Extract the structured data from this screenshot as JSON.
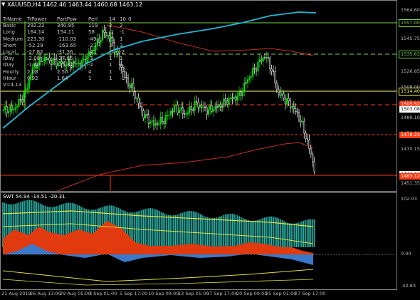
{
  "header": {
    "symbol_icon": "triangle-down-icon",
    "title": "XAUUSD,H4  1462.46 1463.44 1460.68 1463.12"
  },
  "info_table": {
    "columns": [
      "TrName",
      "TrPower",
      "PartPow",
      "Perl",
      "14",
      "10",
      "0"
    ],
    "rows": [
      [
        "Basic",
        "292.22",
        "340.95",
        "119",
        "2",
        "2"
      ],
      [
        "Long",
        "164.14",
        "154.11",
        "58",
        "-1",
        "-1"
      ],
      [
        "Medium",
        "223.30",
        "-110.03",
        "-49",
        "-1",
        "1"
      ],
      [
        "Short",
        "-52.29",
        "-163.65",
        "-21",
        "3",
        "3"
      ],
      [
        "Local",
        "-27.82",
        "-31.36",
        "-21",
        "-1",
        "-2"
      ],
      [
        "IDay",
        "-2.08",
        "-27.85",
        "-1",
        "1",
        "1"
      ],
      [
        "IDay",
        "-1.40",
        "-25.32",
        "-2",
        "1",
        "1"
      ],
      [
        "Hourly",
        "2.08",
        "2.50",
        "4",
        "1",
        "1"
      ],
      [
        "IHour",
        "0.92",
        "1.64",
        "1",
        "1",
        "-1"
      ]
    ],
    "footer": "V=4.13"
  },
  "price_axis": {
    "ticks": [
      "1564.60",
      "1545.75",
      "1526.85",
      "1508.00",
      "1498.60",
      "1489.10",
      "1479.60",
      "1470.15",
      "1451.35"
    ],
    "tags": [
      {
        "text": "1557.00",
        "color": "#7bd44a",
        "bg": "#000"
      },
      {
        "text": "1535.63",
        "color": "#7bd44a",
        "bg": "#000"
      },
      {
        "text": "1514.40",
        "color": "#ffff66",
        "bg": "#000"
      },
      {
        "text": "1505.52",
        "color": "#ffffff",
        "bg": "#ff3b14"
      },
      {
        "text": "1503.08",
        "color": "#000000",
        "bg": "#ffffff"
      },
      {
        "text": "1478.23",
        "color": "#ffffff",
        "bg": "#ff3b14"
      },
      {
        "text": "1472.13",
        "color": "#000000",
        "bg": "#ffffff"
      },
      {
        "text": "1463.12",
        "color": "#ffffff",
        "bg": "#ff3b14"
      }
    ]
  },
  "indicator": {
    "label": "SWT 54.94 -14.51 -20.31",
    "axis_ticks": [
      "102.03",
      "0.00",
      "-40.83"
    ]
  },
  "time_axis": {
    "labels": [
      "21 Aug 2019",
      "26 Aug 13:00",
      "29 Aug 05:00",
      "3 Sep 01:00",
      "5 Sep 17:00",
      "10 Sep 09:00",
      "13 Sep 01:00",
      "17 Sep 17:00",
      "20 Sep 09:00",
      "25 Sep 01:00",
      "27 Sep 17:00"
    ]
  },
  "colors": {
    "background": "#000000",
    "bull_candle": "#00e000",
    "bear_candle": "#ffffff",
    "ma_slow": "#22b8d8",
    "ma_envelope": "#c0321e",
    "histogram_teal": "#2ab3a8",
    "histogram_red": "#e03a0e",
    "histogram_blue": "#3c78c8",
    "signal_yellow": "#e0e040"
  }
}
